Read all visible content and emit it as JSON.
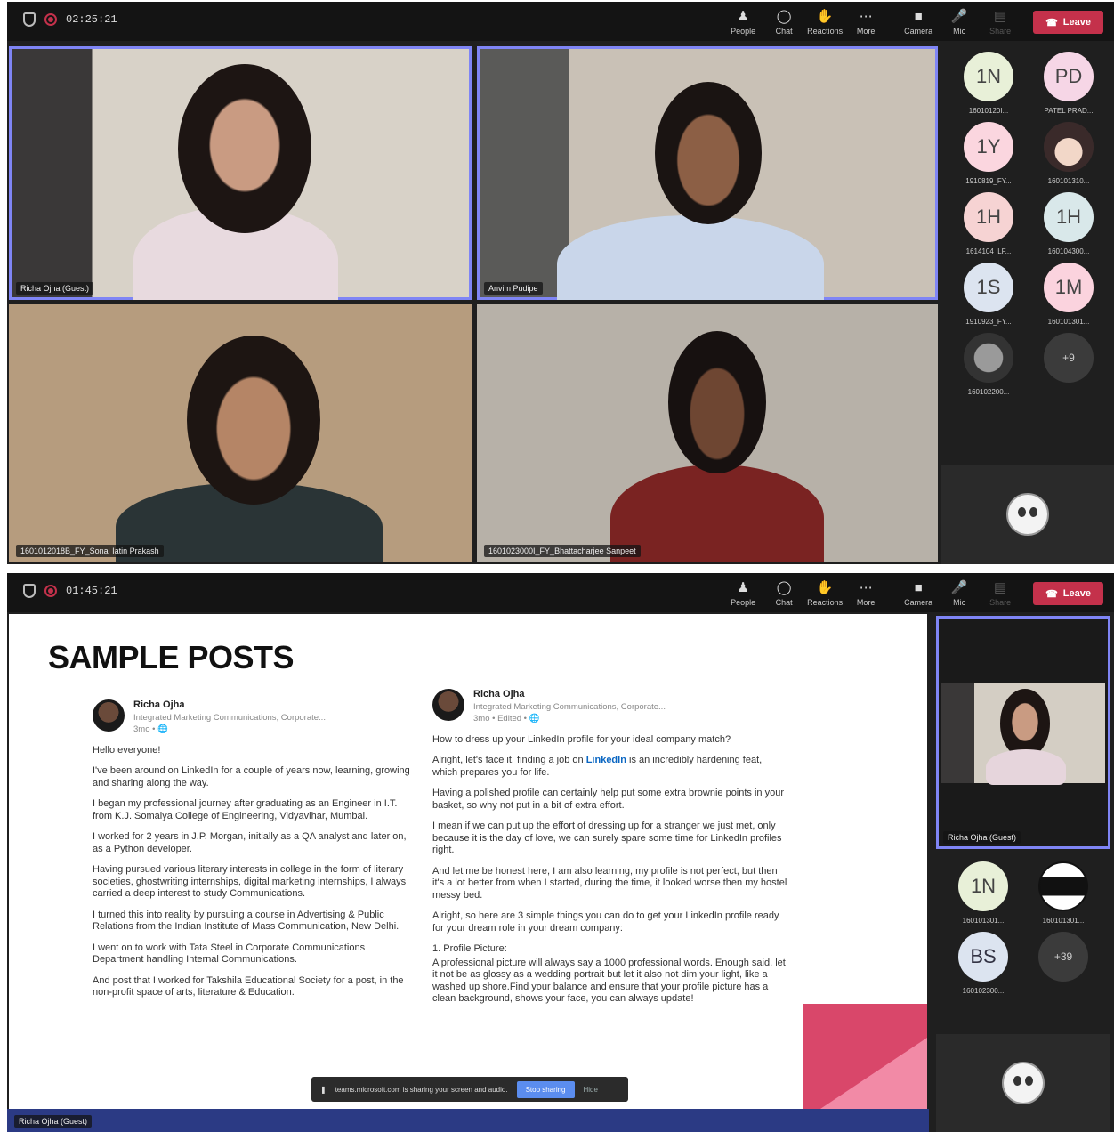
{
  "controls": {
    "people": "People",
    "chat": "Chat",
    "reactions": "Reactions",
    "more": "More",
    "camera": "Camera",
    "mic": "Mic",
    "share": "Share",
    "leave": "Leave"
  },
  "meeting1": {
    "timer": "02:25:21",
    "tiles": [
      {
        "name": "Richa Ojha (Guest)"
      },
      {
        "name": "Anvim Pudipe"
      },
      {
        "name": "1601012018B_FY_Sonal Iatin Prakash"
      },
      {
        "name": "1601023000I_FY_Bhattacharjee Sanpeet"
      }
    ],
    "participants": [
      {
        "initials": "1N",
        "name": "16010120I..."
      },
      {
        "initials": "PD",
        "name": "PATEL PRAD..."
      },
      {
        "initials": "1Y",
        "name": "1910819_FY..."
      },
      {
        "initials": "",
        "name": "160101310..."
      },
      {
        "initials": "1H",
        "name": "1614104_LF..."
      },
      {
        "initials": "1H",
        "name": "160104300..."
      },
      {
        "initials": "1S",
        "name": "1910923_FY..."
      },
      {
        "initials": "1M",
        "name": "160101301..."
      },
      {
        "initials": "",
        "name": "160102200..."
      },
      {
        "initials": "+9",
        "name": ""
      }
    ]
  },
  "meeting2": {
    "timer": "01:45:21",
    "presenter_name": "Richa Ojha (Guest)",
    "bottom_name": "Richa Ojha (Guest)",
    "participants": [
      {
        "initials": "1N",
        "name": "160101301..."
      },
      {
        "initials": "",
        "name": "160101301..."
      },
      {
        "initials": "BS",
        "name": "160102300..."
      },
      {
        "initials": "+39",
        "name": ""
      }
    ],
    "share_bar": {
      "text": "teams.microsoft.com is sharing your screen and audio.",
      "stop": "Stop sharing",
      "hide": "Hide"
    }
  },
  "slide": {
    "title": "SAMPLE POSTS",
    "post1": {
      "author": "Richa Ojha",
      "headline": "Integrated Marketing Communications, Corporate...",
      "meta": "3mo • 🌐",
      "paras": [
        "Hello everyone!",
        "I've been around on LinkedIn for a couple of years now, learning, growing and sharing along the way.",
        "I began my professional journey after graduating as an Engineer in I.T. from K.J. Somaiya College of Engineering, Vidyavihar, Mumbai.",
        "I worked for 2 years in J.P. Morgan, initially as a QA analyst and later on, as a Python developer.",
        "Having pursued various literary interests in college in the form of literary societies, ghostwriting internships, digital marketing internships, I always carried a deep interest to study Communications.",
        "I turned this into reality by pursuing a course in Advertising & Public Relations from the Indian Institute of Mass Communication, New Delhi.",
        "I went on to work with Tata Steel in Corporate Communications Department handling Internal Communications.",
        "And post that I worked for Takshila Educational Society for a post, in the non-profit space of arts, literature & Education."
      ]
    },
    "post2": {
      "author": "Richa Ojha",
      "headline": "Integrated Marketing Communications, Corporate...",
      "meta": "3mo • Edited • 🌐",
      "p1": "How to dress up your LinkedIn profile for your ideal company match?",
      "p2_pre": "Alright, let's face it, finding a job on ",
      "p2_link": "LinkedIn",
      "p2_post": " is an incredibly hardening feat, which prepares you for life.",
      "p3": "Having a polished profile can certainly help put some extra brownie points in your basket, so why not put in a bit of extra effort.",
      "p4": "I mean if we can put up the effort of dressing up for a stranger we just met, only because it is the day of love, we can surely spare some time for LinkedIn profiles right.",
      "p5": "And let me be honest here, I am also learning, my profile is not perfect, but then it's a lot better from when I started, during the time, it looked worse then my hostel messy bed.",
      "p6": "Alright, so here are 3 simple things you can do to get your LinkedIn profile ready for your dream role in your dream company:",
      "p7": "1. Profile Picture:",
      "p8": "A professional picture will always say a 1000 professional words. Enough said, let it not be as glossy as a wedding portrait but let it also not dim your light, like a washed up shore.Find your balance and ensure that your profile picture has a clean background, shows your face, you can always update!"
    }
  }
}
